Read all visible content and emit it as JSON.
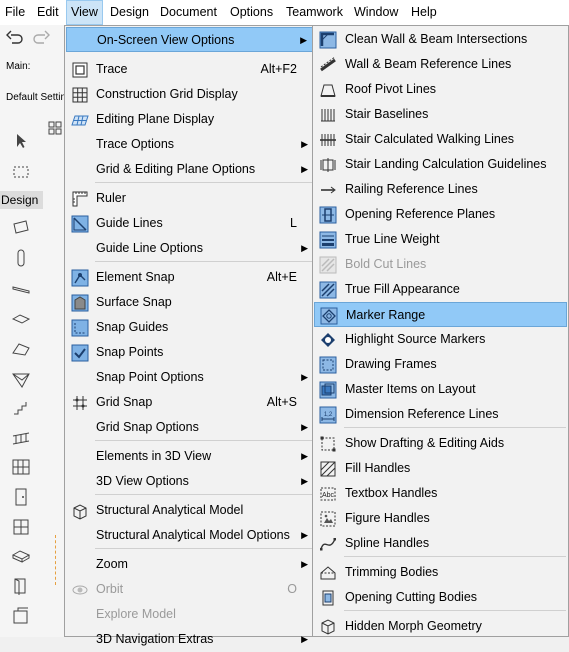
{
  "menubar": {
    "items": [
      "File",
      "Edit",
      "View",
      "Design",
      "Document",
      "Options",
      "Teamwork",
      "Window",
      "Help"
    ]
  },
  "left_strip": {
    "main_label": "Main:",
    "default_settings": "Default Settings",
    "design_label": "Design"
  },
  "view_menu": {
    "items": [
      {
        "label": "On-Screen View Options",
        "icon": "none",
        "submenu": true,
        "highlighted": true
      },
      {
        "label": "Trace",
        "shortcut": "Alt+F2",
        "icon": "trace-icon"
      },
      {
        "label": "Construction Grid Display",
        "icon": "grid-icon"
      },
      {
        "label": "Editing Plane Display",
        "icon": "editing-plane-icon"
      },
      {
        "label": "Trace Options",
        "submenu": true
      },
      {
        "label": "Grid & Editing Plane Options",
        "submenu": true
      },
      {
        "label": "Ruler",
        "icon": "ruler-icon"
      },
      {
        "label": "Guide Lines",
        "shortcut": "L",
        "icon": "guide-lines-icon"
      },
      {
        "label": "Guide Line Options",
        "submenu": true
      },
      {
        "label": "Element Snap",
        "shortcut": "Alt+E",
        "icon": "element-snap-icon"
      },
      {
        "label": "Surface Snap",
        "icon": "surface-snap-icon"
      },
      {
        "label": "Snap Guides",
        "icon": "snap-guides-icon"
      },
      {
        "label": "Snap Points",
        "icon": "snap-points-icon"
      },
      {
        "label": "Snap Point Options",
        "submenu": true
      },
      {
        "label": "Grid Snap",
        "shortcut": "Alt+S",
        "icon": "grid-snap-icon"
      },
      {
        "label": "Grid Snap Options",
        "submenu": true
      },
      {
        "label": "Elements in 3D View",
        "submenu": true
      },
      {
        "label": "3D View Options",
        "submenu": true
      },
      {
        "label": "Structural Analytical Model",
        "icon": "structural-model-icon"
      },
      {
        "label": "Structural Analytical Model Options",
        "submenu": true
      },
      {
        "label": "Zoom",
        "submenu": true
      },
      {
        "label": "Orbit",
        "shortcut": "O",
        "icon": "orbit-icon",
        "disabled": true
      },
      {
        "label": "Explore Model",
        "icon": "explore-icon",
        "disabled": true
      },
      {
        "label": "3D Navigation Extras",
        "submenu": true
      }
    ]
  },
  "submenu": {
    "items": [
      {
        "label": "Clean Wall & Beam Intersections",
        "icon": "clean-intersections-icon"
      },
      {
        "label": "Wall & Beam Reference Lines",
        "icon": "reference-lines-icon"
      },
      {
        "label": "Roof Pivot Lines",
        "icon": "roof-pivot-icon"
      },
      {
        "label": "Stair Baselines",
        "icon": "stair-baselines-icon"
      },
      {
        "label": "Stair Calculated Walking Lines",
        "icon": "walking-lines-icon"
      },
      {
        "label": "Stair Landing Calculation Guidelines",
        "icon": "landing-guidelines-icon"
      },
      {
        "label": "Railing Reference Lines",
        "icon": "railing-reference-icon"
      },
      {
        "label": "Opening Reference Planes",
        "icon": "opening-planes-icon"
      },
      {
        "label": "True Line Weight",
        "icon": "line-weight-icon"
      },
      {
        "label": "Bold Cut Lines",
        "icon": "bold-cut-icon",
        "disabled": true
      },
      {
        "label": "True Fill Appearance",
        "icon": "fill-appearance-icon"
      },
      {
        "label": "Marker Range",
        "icon": "marker-range-icon",
        "highlighted": true
      },
      {
        "label": "Highlight Source Markers",
        "icon": "source-markers-icon"
      },
      {
        "label": "Drawing Frames",
        "icon": "drawing-frames-icon"
      },
      {
        "label": "Master Items on Layout",
        "icon": "master-items-icon"
      },
      {
        "label": "Dimension Reference Lines",
        "icon": "dimension-icon"
      },
      {
        "label": "Show Drafting & Editing Aids",
        "icon": "drafting-aids-icon"
      },
      {
        "label": "Fill Handles",
        "icon": "fill-handles-icon"
      },
      {
        "label": "Textbox Handles",
        "icon": "textbox-handles-icon"
      },
      {
        "label": "Figure Handles",
        "icon": "figure-handles-icon"
      },
      {
        "label": "Spline Handles",
        "icon": "spline-handles-icon"
      },
      {
        "label": "Trimming Bodies",
        "icon": "trimming-bodies-icon"
      },
      {
        "label": "Opening Cutting Bodies",
        "icon": "cutting-bodies-icon"
      },
      {
        "label": "Hidden Morph Geometry",
        "icon": "morph-geometry-icon"
      }
    ]
  },
  "colors": {
    "highlight": "#91c9f7",
    "menu_bg": "#f2f2f2",
    "active_menu_bg": "#cce4f7"
  }
}
